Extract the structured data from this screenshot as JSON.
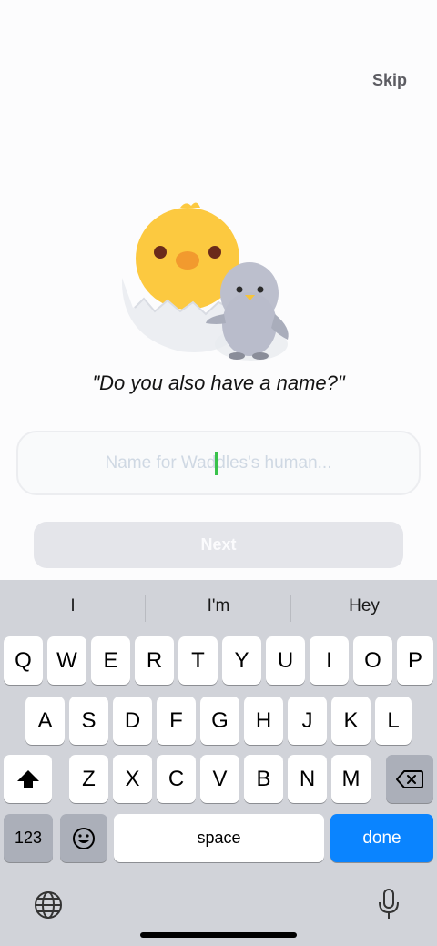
{
  "header": {
    "skip_label": "Skip"
  },
  "prompt": {
    "question": "\"Do you also have a name?\""
  },
  "form": {
    "name_placeholder": "Name for Waddles's human...",
    "name_value": "",
    "next_label": "Next"
  },
  "keyboard": {
    "suggestions": [
      "I",
      "I'm",
      "Hey"
    ],
    "row1": [
      "Q",
      "W",
      "E",
      "R",
      "T",
      "Y",
      "U",
      "I",
      "O",
      "P"
    ],
    "row2": [
      "A",
      "S",
      "D",
      "F",
      "G",
      "H",
      "J",
      "K",
      "L"
    ],
    "row3": [
      "Z",
      "X",
      "C",
      "V",
      "B",
      "N",
      "M"
    ],
    "numbers_label": "123",
    "space_label": "space",
    "done_label": "done"
  },
  "colors": {
    "accent_blue": "#0a84ff",
    "caret_green": "#39c24b",
    "chick_yellow": "#fcc940",
    "penguin_gray": "#b9bccb"
  }
}
